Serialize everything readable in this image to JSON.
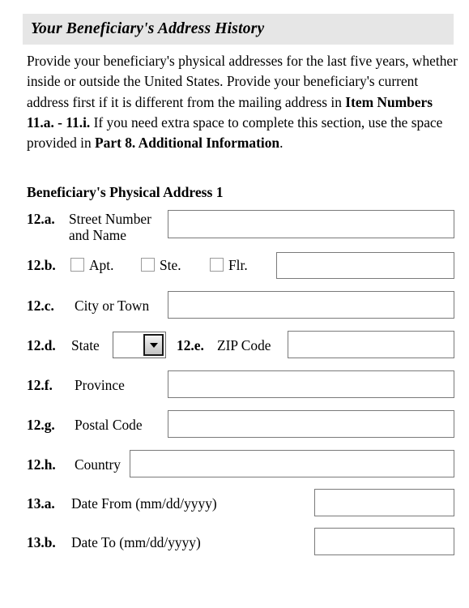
{
  "section": {
    "title": "Your Beneficiary's Address History"
  },
  "intro": {
    "part1": "Provide your beneficiary's physical addresses for the last five years, whether inside or outside the United States.  Provide your beneficiary's current address first if it is different from the mailing address in ",
    "bold1": "Item Numbers 11.a. - 11.i.",
    "part2": "  If you need extra space to complete this section, use the space provided in ",
    "bold2": "Part 8. Additional Information",
    "part3": "."
  },
  "subheading": "Beneficiary's Physical Address 1",
  "fields": {
    "street": {
      "number": "12.a.",
      "label": "Street Number and Name",
      "value": ""
    },
    "unit": {
      "number": "12.b.",
      "options": [
        {
          "label": "Apt.",
          "checked": false
        },
        {
          "label": "Ste.",
          "checked": false
        },
        {
          "label": "Flr.",
          "checked": false
        }
      ],
      "value": ""
    },
    "city": {
      "number": "12.c.",
      "label": "City or Town",
      "value": ""
    },
    "state": {
      "number": "12.d.",
      "label": "State",
      "selected": ""
    },
    "zip": {
      "number": "12.e.",
      "label": "ZIP Code",
      "value": ""
    },
    "province": {
      "number": "12.f.",
      "label": "Province",
      "value": ""
    },
    "postal": {
      "number": "12.g.",
      "label": "Postal Code",
      "value": ""
    },
    "country": {
      "number": "12.h.",
      "label": "Country",
      "value": ""
    },
    "date_from": {
      "number": "13.a.",
      "label": "Date From (mm/dd/yyyy)",
      "value": ""
    },
    "date_to": {
      "number": "13.b.",
      "label": "Date To (mm/dd/yyyy)",
      "value": ""
    }
  }
}
